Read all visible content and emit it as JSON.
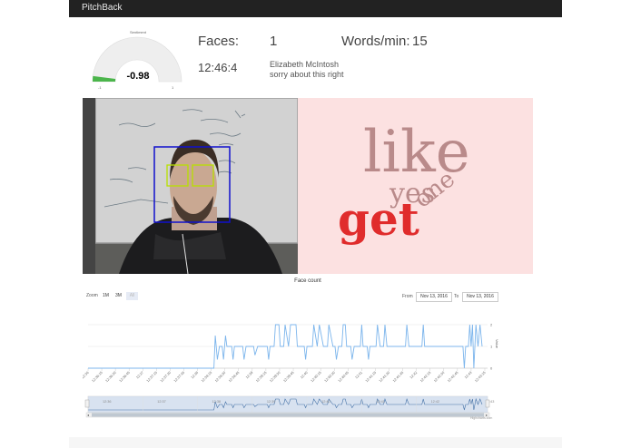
{
  "app": {
    "title": "PitchBack"
  },
  "sentiment": {
    "label": "Sentiment",
    "value": "-0.98",
    "min": "-1",
    "max": "1",
    "level": 0.01,
    "fill_color": "#4bb54b"
  },
  "stats": {
    "faces_label": "Faces:",
    "faces_value": "1",
    "wpm_label": "Words/min:",
    "wpm_value": "15",
    "time": "12:46:4",
    "speaker": "Elizabeth McIntosh",
    "transcript": "sorry about this right"
  },
  "word_cloud": {
    "background": "#fce1e1",
    "words": [
      {
        "text": "like",
        "color": "#b98a8a"
      },
      {
        "text": "yes",
        "color": "#b98a8a"
      },
      {
        "text": "one",
        "color": "#b98a8a"
      },
      {
        "text": "get",
        "color": "#e02c2c"
      }
    ]
  },
  "chart": {
    "title": "Face count",
    "zoom_label": "Zoom",
    "zoom_buttons": [
      "1M",
      "3M",
      "All"
    ],
    "from_label": "From",
    "from_value": "Nov 13, 2016",
    "to_label": "To",
    "to_value": "Nov 13, 2016",
    "y_axis_label": "Value",
    "credit": "Highcharts.com"
  },
  "chart_data": {
    "type": "line",
    "title": "Face count",
    "ylabel": "Value",
    "ylim": [
      0,
      2
    ],
    "yticks": [
      "0",
      "1",
      "2"
    ],
    "x_ticks": [
      "12:36",
      "12:36:15",
      "12:36:30",
      "12:36:45",
      "12:37",
      "12:37:15",
      "12:37:30",
      "12:37:45",
      "12:38",
      "12:38:15",
      "12:38:30",
      "12:38:45",
      "12:39",
      "12:39:15",
      "12:39:30",
      "12:39:45",
      "12:40",
      "12:40:15",
      "12:40:30",
      "12:40:45",
      "12:41",
      "12:41:15",
      "12:41:30",
      "12:41:45",
      "12:42",
      "12:42:15",
      "12:42:30",
      "12:42:45",
      "12:43",
      "12:43:15"
    ],
    "navigator_ticks": [
      "12:36",
      "12:37",
      "12:38",
      "12:39",
      "12:40",
      "12:41",
      "12:42",
      "12:43"
    ],
    "series": [
      {
        "color": "#7cb5ec",
        "points": [
          [
            0,
            0
          ],
          [
            9.2,
            0
          ],
          [
            9.3,
            1.5
          ],
          [
            9.45,
            0.4
          ],
          [
            9.6,
            1
          ],
          [
            9.8,
            1
          ],
          [
            9.9,
            0.4
          ],
          [
            10.05,
            1.5
          ],
          [
            10.15,
            1
          ],
          [
            10.5,
            1
          ],
          [
            10.6,
            0.4
          ],
          [
            10.7,
            1
          ],
          [
            11.3,
            1
          ],
          [
            11.4,
            0.4
          ],
          [
            11.55,
            1
          ],
          [
            12.1,
            1
          ],
          [
            12.2,
            0.6
          ],
          [
            12.4,
            1
          ],
          [
            13.1,
            1
          ],
          [
            13.2,
            0.4
          ],
          [
            13.3,
            1
          ],
          [
            13.6,
            1
          ],
          [
            13.7,
            2
          ],
          [
            13.95,
            2
          ],
          [
            14.05,
            1
          ],
          [
            14.3,
            1
          ],
          [
            14.4,
            2
          ],
          [
            14.65,
            1
          ],
          [
            14.8,
            2
          ],
          [
            15.2,
            2
          ],
          [
            15.3,
            1
          ],
          [
            15.8,
            1
          ],
          [
            15.9,
            0.4
          ],
          [
            16,
            1
          ],
          [
            16.4,
            1
          ],
          [
            16.5,
            2
          ],
          [
            16.75,
            1
          ],
          [
            16.9,
            2
          ],
          [
            17.2,
            1
          ],
          [
            17.5,
            1
          ],
          [
            17.6,
            2
          ],
          [
            17.9,
            1
          ],
          [
            18.05,
            1
          ],
          [
            18.15,
            0.4
          ],
          [
            18.3,
            1
          ],
          [
            18.55,
            1
          ],
          [
            18.65,
            2
          ],
          [
            18.8,
            2
          ],
          [
            18.9,
            1
          ],
          [
            19.2,
            1
          ],
          [
            19.3,
            0.4
          ],
          [
            19.45,
            1
          ],
          [
            19.9,
            1
          ],
          [
            20,
            2
          ],
          [
            20.1,
            1
          ],
          [
            20.4,
            1
          ],
          [
            20.5,
            0.4
          ],
          [
            20.6,
            1
          ],
          [
            21.05,
            1
          ],
          [
            21.15,
            2
          ],
          [
            21.35,
            1
          ],
          [
            21.6,
            1
          ],
          [
            21.7,
            2
          ],
          [
            21.85,
            1
          ],
          [
            23.2,
            1
          ],
          [
            23.3,
            2
          ],
          [
            23.45,
            1
          ],
          [
            24.2,
            1
          ],
          [
            24.4,
            1
          ],
          [
            24.5,
            2
          ],
          [
            24.6,
            1
          ],
          [
            27.4,
            1
          ],
          [
            27.5,
            0
          ],
          [
            27.6,
            1
          ],
          [
            27.8,
            1
          ],
          [
            27.9,
            2
          ],
          [
            28,
            1
          ],
          [
            28.1,
            2
          ],
          [
            28.2,
            0
          ],
          [
            28.35,
            2
          ],
          [
            28.5,
            1
          ],
          [
            28.65,
            2
          ],
          [
            28.8,
            1
          ]
        ]
      }
    ]
  }
}
